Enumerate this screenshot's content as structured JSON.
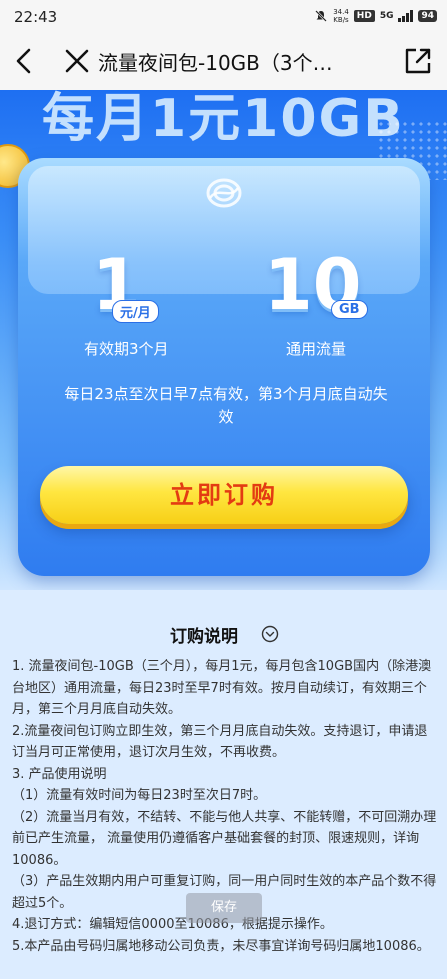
{
  "status_bar": {
    "time": "22:43",
    "net_speed_value": "34.4",
    "net_speed_unit": "KB/s",
    "hd_badge": "HD",
    "signal_label": "5G",
    "battery": "94"
  },
  "nav": {
    "title": "流量夜间包-10GB（3个…",
    "icons": [
      "back-arrow-icon",
      "close-icon",
      "share-icon"
    ]
  },
  "hero": {
    "slogan": "每月1元10GB",
    "price_number": "1",
    "price_unit": "元/月",
    "price_label": "有效期3个月",
    "data_number": "10",
    "data_unit": "GB",
    "data_label": "通用流量",
    "note": "每日23点至次日早7点有效，第3个月月底自动失效",
    "buy_button": "立即订购"
  },
  "description": {
    "title": "订购说明",
    "lines": [
      "1. 流量夜间包-10GB（三个月），每月1元，每月包含10GB国内（除港澳台地区）通用流量，每日23时至早7时有效。按月自动续订，有效期三个月，第三个月月底自动失效。",
      "2.流量夜间包订购立即生效，第三个月月底自动失效。支持退订，申请退订当月可正常使用，退订次月生效，不再收费。",
      "3. 产品使用说明",
      "（1）流量有效时间为每日23时至次日7时。",
      "（2）流量当月有效，不结转、不能与他人共享、不能转赠，不可回溯办理前已产生流量， 流量使用仍遵循客户基础套餐的封顶、限速规则，详询10086。",
      "（3）产品生效期内用户可重复订购，同一用户同时生效的本产品个数不得超过5个。",
      "4.退订方式：编辑短信0000至10086，根据提示操作。",
      "5.本产品由号码归属地移动公司负责，未尽事宜详询号码归属地10086。"
    ]
  },
  "toast": "保存",
  "colors": {
    "brand_blue": "#2f7cf0",
    "button_yellow": "#ffe640",
    "button_text_red": "#e33b12"
  }
}
